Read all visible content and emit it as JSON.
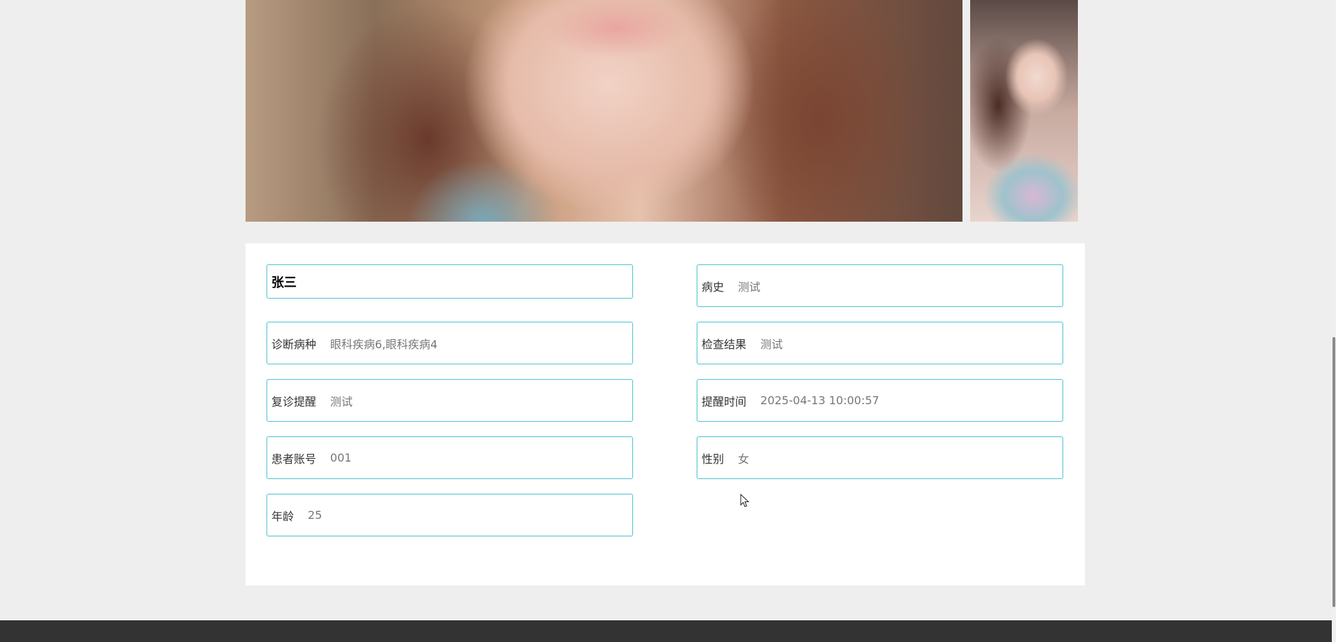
{
  "record": {
    "name": "张三",
    "fields": [
      {
        "label": "病史",
        "value": "测试"
      },
      {
        "label": "诊断病种",
        "value": "眼科疾病6,眼科疾病4"
      },
      {
        "label": "检查结果",
        "value": "测试"
      },
      {
        "label": "复诊提醒",
        "value": "测试"
      },
      {
        "label": "提醒时间",
        "value": "2025-04-13 10:00:57"
      },
      {
        "label": "患者账号",
        "value": "001"
      },
      {
        "label": "性别",
        "value": "女"
      },
      {
        "label": "年龄",
        "value": "25"
      }
    ]
  },
  "colors": {
    "field_border": "#4fc1cf",
    "page_background": "#efeeee",
    "footer": "#333333"
  }
}
